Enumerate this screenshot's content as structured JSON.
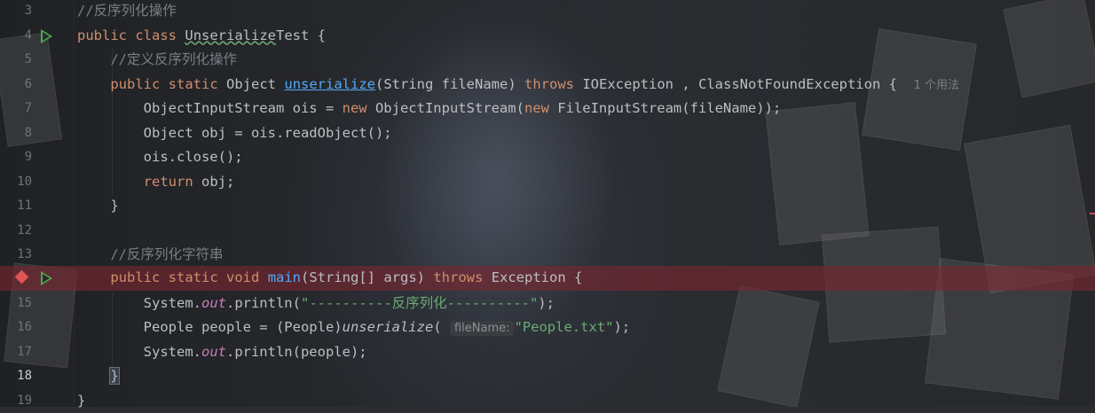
{
  "editor": {
    "lines": [
      {
        "n": "3"
      },
      {
        "n": "4"
      },
      {
        "n": "5"
      },
      {
        "n": "6"
      },
      {
        "n": "7"
      },
      {
        "n": "8"
      },
      {
        "n": "9"
      },
      {
        "n": "10"
      },
      {
        "n": "11"
      },
      {
        "n": "12"
      },
      {
        "n": "13"
      },
      {
        "n": "14"
      },
      {
        "n": "15"
      },
      {
        "n": "16"
      },
      {
        "n": "17"
      },
      {
        "n": "18"
      },
      {
        "n": "19"
      }
    ],
    "code": {
      "l3_comment": "//反序列化操作",
      "l4_public": "public",
      "l4_class": "class",
      "l4_name_a": "Unserialize",
      "l4_name_b": "Test {",
      "l5_comment": "//定义反序列化操作",
      "l6_public": "public",
      "l6_static": "static",
      "l6_type": "Object",
      "l6_method": "unserialize",
      "l6_params": "(String fileName)",
      "l6_throws": "throws",
      "l6_exc": "IOException , ClassNotFoundException {",
      "l6_usage": "1 个用法",
      "l7_a": "ObjectInputStream ois = ",
      "l7_new1": "new",
      "l7_b": " ObjectInputStream(",
      "l7_new2": "new",
      "l7_c": " FileInputStream(fileName));",
      "l8": "Object obj = ois.readObject();",
      "l9": "ois.close();",
      "l10_return": "return",
      "l10_b": " obj;",
      "l11": "}",
      "l13_comment": "//反序列化字符串",
      "l14_public": "public",
      "l14_static": "static",
      "l14_void": "void",
      "l14_main": "main",
      "l14_params": "(String[] args)",
      "l14_throws": "throws",
      "l14_exc": "Exception ",
      "l14_brace": "{",
      "l15_a": "System.",
      "l15_out": "out",
      "l15_b": ".println(",
      "l15_str": "\"----------反序列化----------\"",
      "l15_c": ");",
      "l16_a": "People people = (People)",
      "l16_call": "unserialize",
      "l16_b": "( ",
      "l16_hint": "fileName:",
      "l16_str": "\"People.txt\"",
      "l16_c": ");",
      "l17_a": "System.",
      "l17_out": "out",
      "l17_b": ".println(people);",
      "l18": "}",
      "l19": "}"
    }
  }
}
